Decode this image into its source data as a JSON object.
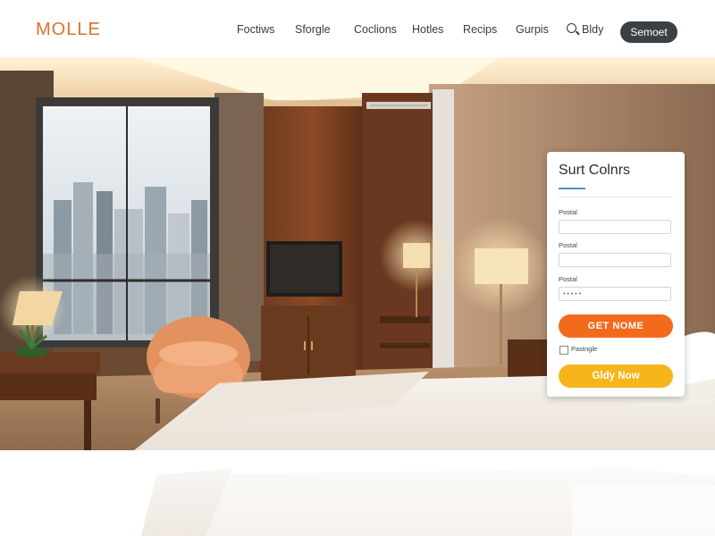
{
  "header": {
    "logo": "MOLLE",
    "logo_sub": "",
    "nav": [
      "Foctiws",
      "Sforgle",
      "Coclions",
      "Hotles",
      "Recips",
      "Gurpis"
    ],
    "search_label": "Bldy",
    "cta_label": "Semoet"
  },
  "booking": {
    "title": "Surt Colnrs",
    "fields": [
      {
        "label": "Postal",
        "value": ""
      },
      {
        "label": "Postal",
        "value": ""
      },
      {
        "label": "Postal",
        "value": "• • • • •"
      }
    ],
    "primary_button": "GET NOME",
    "checkbox_label": "Pastngle",
    "secondary_button": "Gldy Now"
  },
  "colors": {
    "brand": "#d9722c",
    "primary_button": "#f26a1b",
    "secondary_button": "#f5b51b",
    "dark_pill": "#3c3f43",
    "accent_underline": "#4a90d9"
  },
  "icons": [
    "search-icon"
  ]
}
